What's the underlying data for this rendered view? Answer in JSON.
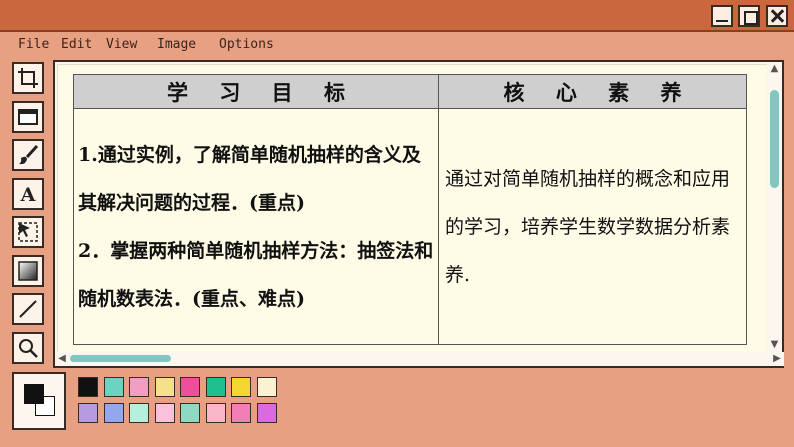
{
  "window": {
    "minimize_icon": "minimize-icon",
    "maximize_icon": "maximize-icon",
    "close_icon": "close-icon"
  },
  "menu": [
    "File",
    "Edit",
    "View",
    "Image",
    "Options"
  ],
  "tools": [
    "crop-icon",
    "rectangle-icon",
    "brush-icon",
    "text-icon",
    "select-icon",
    "gradient-icon",
    "line-icon",
    "zoom-icon"
  ],
  "table": {
    "headers": [
      "学 习 目 标",
      "核 心 素 养"
    ],
    "goals": [
      "1.通过实例，了解简单随机抽样的含义及其解决问题的过程．(重点)",
      "2．掌握两种简单随机抽样方法：抽签法和随机数表法．(重点、难点)"
    ],
    "core": "通过对简单随机抽样的概念和应用的学习，培养学生数学数据分析素养."
  },
  "palette": {
    "foreground": "#111111",
    "background": "#ffffff",
    "row1": [
      "#111111",
      "#6dd3c0",
      "#f59cc4",
      "#f6e08c",
      "#ef4f9a",
      "#1fbf8f",
      "#f7d531",
      "#fbf2d4"
    ],
    "row2": [
      "#b79be0",
      "#93a7ee",
      "#b6f0dc",
      "#f8c2d8",
      "#8fd9c2",
      "#f7b7c9",
      "#f27fb4",
      "#d96ae0"
    ]
  }
}
